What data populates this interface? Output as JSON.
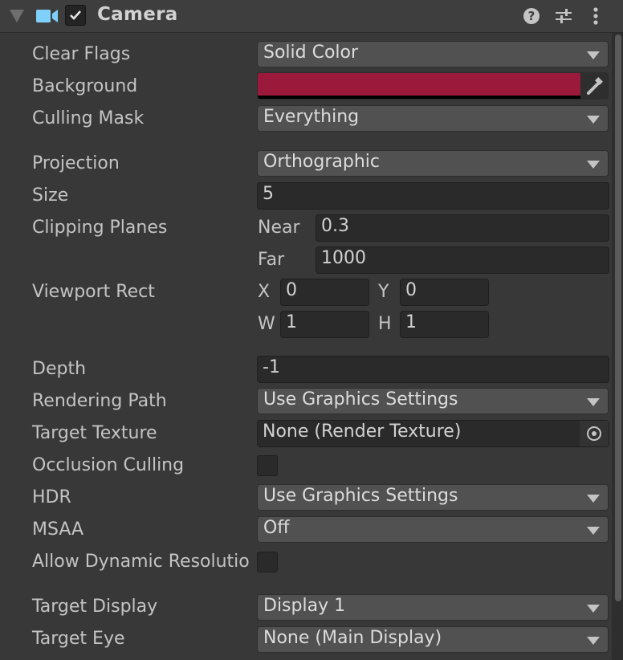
{
  "component": {
    "title": "Camera",
    "enabled": true,
    "icons": {
      "foldout": "foldout-arrow-icon",
      "type": "camera-icon",
      "help": "help-icon",
      "presets": "presets-sliders-icon",
      "menu": "kebab-menu-icon"
    }
  },
  "properties": {
    "clear_flags": {
      "label": "Clear Flags",
      "value": "Solid Color"
    },
    "background": {
      "label": "Background",
      "color": "#9b1a3c",
      "icon": "eyedropper-icon"
    },
    "culling_mask": {
      "label": "Culling Mask",
      "value": "Everything"
    },
    "projection": {
      "label": "Projection",
      "value": "Orthographic"
    },
    "size": {
      "label": "Size",
      "value": "5"
    },
    "clipping_planes": {
      "label": "Clipping Planes",
      "near_label": "Near",
      "near": "0.3",
      "far_label": "Far",
      "far": "1000"
    },
    "viewport_rect": {
      "label": "Viewport Rect",
      "x_label": "X",
      "x": "0",
      "y_label": "Y",
      "y": "0",
      "w_label": "W",
      "w": "1",
      "h_label": "H",
      "h": "1"
    },
    "depth": {
      "label": "Depth",
      "value": "-1"
    },
    "rendering_path": {
      "label": "Rendering Path",
      "value": "Use Graphics Settings"
    },
    "target_texture": {
      "label": "Target Texture",
      "value": "None (Render Texture)",
      "icon": "object-picker-icon"
    },
    "occlusion_culling": {
      "label": "Occlusion Culling",
      "checked": false
    },
    "hdr": {
      "label": "HDR",
      "value": "Use Graphics Settings"
    },
    "msaa": {
      "label": "MSAA",
      "value": "Off"
    },
    "allow_dynamic_resolution": {
      "label": "Allow Dynamic Resolutio",
      "checked": false
    },
    "target_display": {
      "label": "Target Display",
      "value": "Display 1"
    },
    "target_eye": {
      "label": "Target Eye",
      "value": "None (Main Display)"
    }
  }
}
